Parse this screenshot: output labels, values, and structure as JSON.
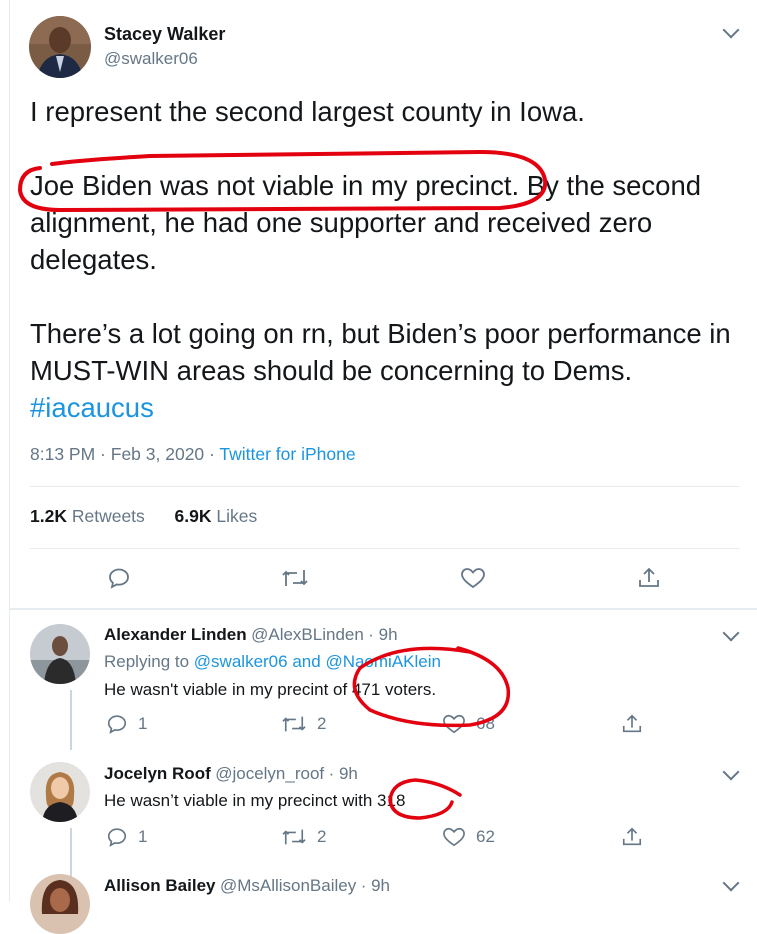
{
  "main_tweet": {
    "author_name": "Stacey Walker",
    "author_handle": "@swalker06",
    "paragraphs": [
      "I represent the second largest county in Iowa.",
      "Joe Biden was not viable in my precinct. By the second alignment, he had one supporter and received zero delegates.",
      "There’s a lot going on rn, but Biden’s poor performance in MUST-WIN areas should be concerning to Dems."
    ],
    "hashtag": "#iacaucus",
    "time": "8:13 PM",
    "separator": " · ",
    "date": "Feb 3, 2020",
    "source": "Twitter for iPhone",
    "retweets_count": "1.2K",
    "retweets_label": "Retweets",
    "likes_count": "6.9K",
    "likes_label": "Likes"
  },
  "replies": [
    {
      "name": "Alexander Linden",
      "handle": "@AlexBLinden",
      "time": "· 9h",
      "replying_prefix": "Replying to",
      "replying_user1": "@swalker06",
      "replying_and": "and",
      "replying_user2": "@NaomiAKlein",
      "text": "He wasn't viable in my precint of 471 voters.",
      "reply_count": "1",
      "retweet_count": "2",
      "like_count": "68"
    },
    {
      "name": "Jocelyn Roof",
      "handle": "@jocelyn_roof",
      "time": "· 9h",
      "text": "He wasn’t viable in my precinct with 318",
      "reply_count": "1",
      "retweet_count": "2",
      "like_count": "62"
    },
    {
      "name": "Allison Bailey",
      "handle": "@MsAllisonBailey",
      "time": "· 9h"
    }
  ],
  "colors": {
    "link": "#1b95e0",
    "secondary_text": "#657786",
    "annotation": "#e3000f"
  },
  "icons": [
    "chevron-down-icon",
    "reply-icon",
    "retweet-icon",
    "like-icon",
    "share-icon"
  ]
}
